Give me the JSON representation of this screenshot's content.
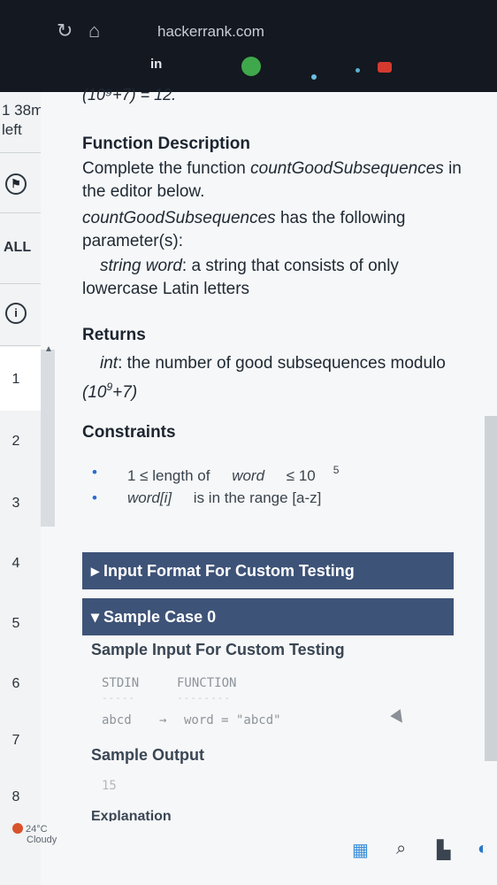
{
  "browser": {
    "url": "hackerrank.com",
    "extensions": {
      "linkedin_label": "in"
    }
  },
  "sidebar": {
    "timer_line1": "1 38m",
    "timer_line2": "left",
    "all_label": "ALL",
    "questions": [
      "1",
      "2",
      "3",
      "4",
      "5",
      "6",
      "7",
      "8"
    ]
  },
  "problem": {
    "mod_tail": "(10⁹+7) = 12.",
    "function_description": {
      "heading": "Function Description",
      "line1_prefix": "Complete the function ",
      "function_name": "countGoodSubsequences",
      "line1_suffix": " in",
      "line2": "the editor below.",
      "param_fn": "countGoodSubsequences",
      "param_text": " has the following",
      "param_text2": "parameter(s):",
      "param_type": "string word",
      "param_desc": ": a string that consists of only",
      "param_desc2": "lowercase Latin letters"
    },
    "returns": {
      "heading": "Returns",
      "type": "int",
      "desc": ": the number of good subsequences modulo",
      "mod": "(10",
      "mod_exp": "9",
      "mod_end": "+7)"
    },
    "constraints": {
      "heading": "Constraints",
      "c1_prefix": "1 ≤ length of ",
      "c1_var": "word",
      "c1_suffix": " ≤ 10",
      "c1_exp": "5",
      "c2_var": "word[i]",
      "c2_text": " is in the range [a-z]"
    },
    "input_format_label": "▸ Input Format For Custom Testing",
    "sample_case_label": "▾ Sample Case 0",
    "sample": {
      "input_heading": "Sample Input For Custom Testing",
      "col_stdin": "STDIN",
      "col_function": "FUNCTION",
      "dash1": "-----",
      "dash2": "--------",
      "stdin_value": "abcd",
      "arrow": "→",
      "function_value": "word = \"abcd\"",
      "output_heading": "Sample Output",
      "output_value": "15",
      "explanation_heading": "Explanation"
    }
  },
  "taskbar": {
    "temperature": "24°C",
    "condition": "Cloudy"
  }
}
